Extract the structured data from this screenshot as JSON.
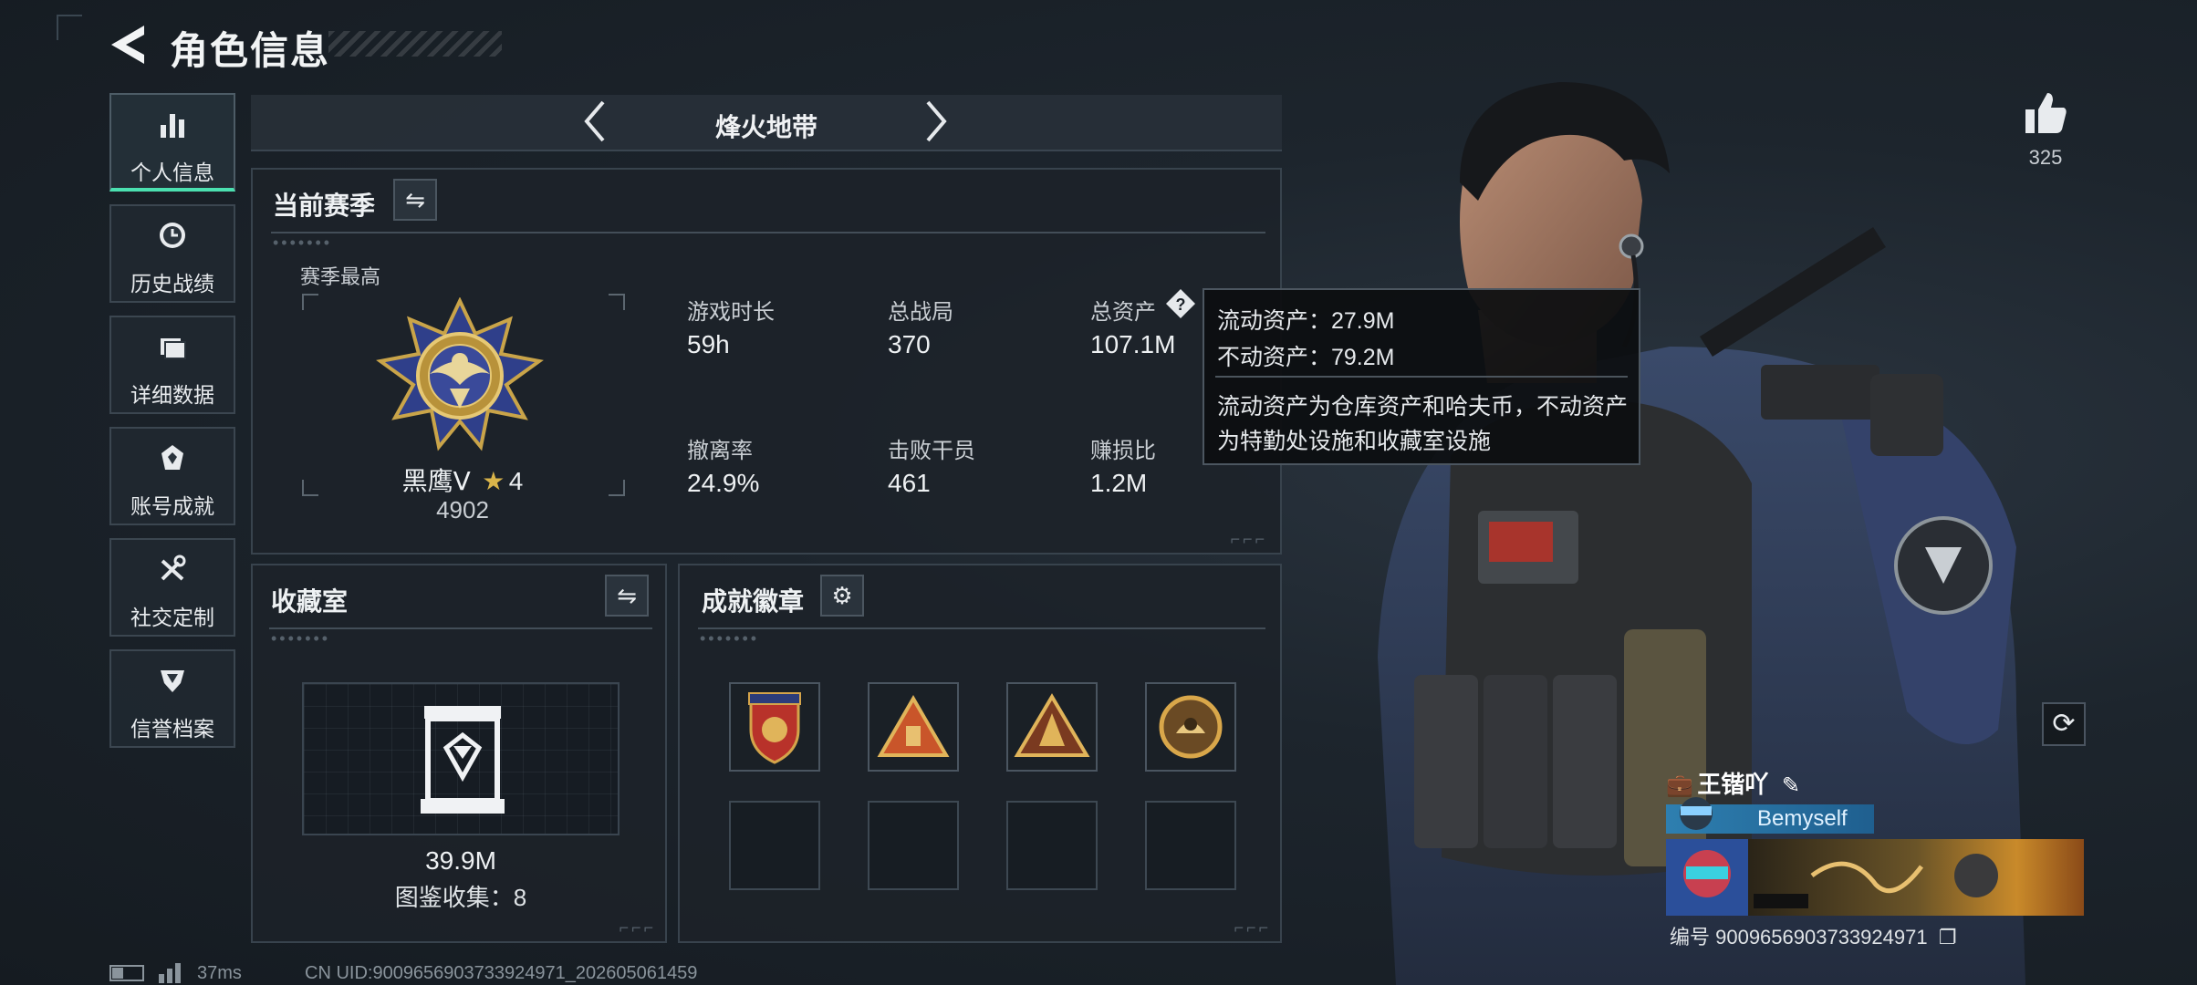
{
  "header": {
    "title": "角色信息"
  },
  "sidebar": {
    "items": [
      {
        "label": "个人信息",
        "icon": "bar-chart-icon"
      },
      {
        "label": "历史战绩",
        "icon": "clock-icon"
      },
      {
        "label": "详细数据",
        "icon": "folder-icon"
      },
      {
        "label": "账号成就",
        "icon": "badge-icon"
      },
      {
        "label": "社交定制",
        "icon": "tools-icon"
      },
      {
        "label": "信誉档案",
        "icon": "shield-icon"
      }
    ]
  },
  "mode": {
    "label": "烽火地带"
  },
  "season": {
    "title": "当前赛季",
    "best_label": "赛季最高",
    "rank_name": "黑鹰Ⅴ",
    "rank_stars": "4",
    "rank_points": "4902",
    "stats": [
      {
        "label": "游戏时长",
        "value": "59h"
      },
      {
        "label": "总战局",
        "value": "370"
      },
      {
        "label": "总资产",
        "value": "107.1M"
      },
      {
        "label": "撤离率",
        "value": "24.9%"
      },
      {
        "label": "击败干员",
        "value": "461"
      },
      {
        "label": "赚损比",
        "value": "1.2M"
      }
    ]
  },
  "tooltip": {
    "liquid": "流动资产：27.9M",
    "fixed": "不动资产：79.2M",
    "desc_line1": "流动资产为仓库资产和哈夫币，不动资产",
    "desc_line2": "为特勤处设施和收藏室设施"
  },
  "collection": {
    "title": "收藏室",
    "value": "39.9M",
    "count_text": "图鉴收集：8"
  },
  "achievements": {
    "title": "成就徽章",
    "badges": [
      {
        "icon": "shield-badge-icon",
        "color": "#b8322a"
      },
      {
        "icon": "triangle-badge-icon",
        "color": "#c9552a"
      },
      {
        "icon": "triangle-tower-badge-icon",
        "color": "#c98a3a"
      },
      {
        "icon": "round-badge-icon",
        "color": "#b8862e"
      }
    ]
  },
  "like": {
    "count": "325"
  },
  "player": {
    "name": "王锴吖",
    "tag": "Bemyself",
    "id_text": "编号 9009656903733924971"
  },
  "footer": {
    "ping": "37ms",
    "uid": "CN UID:9009656903733924971_202605061459"
  },
  "colors": {
    "accent": "#4be0b0",
    "panel": "#1c2229",
    "border": "#38434d"
  }
}
